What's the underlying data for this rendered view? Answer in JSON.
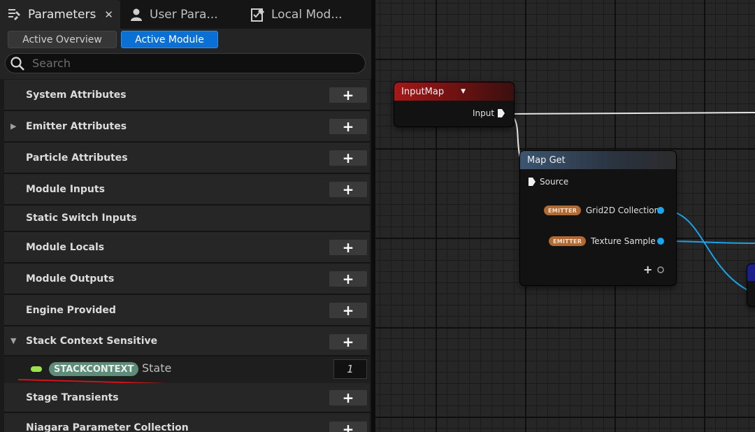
{
  "tabs": [
    {
      "label": "Parameters",
      "icon": "wrench-list-icon",
      "active": true,
      "closable": true
    },
    {
      "label": "User Para...",
      "icon": "person-icon",
      "active": false
    },
    {
      "label": "Local Mod...",
      "icon": "checklist-pencil-icon",
      "active": false
    }
  ],
  "modes": {
    "overview": "Active Overview",
    "module": "Active Module",
    "selected": "Active Module"
  },
  "search": {
    "placeholder": "Search",
    "value": ""
  },
  "categories": {
    "system": "System Attributes",
    "emitter": "Emitter Attributes",
    "particle": "Particle Attributes",
    "module_inputs": "Module Inputs",
    "static_switch": "Static Switch Inputs",
    "module_locals": "Module Locals",
    "module_outputs": "Module Outputs",
    "engine": "Engine Provided",
    "stack_context": "Stack Context Sensitive",
    "stage_transients": "Stage Transients",
    "npc": "Niagara Parameter Collection"
  },
  "param": {
    "namespace": "STACKCONTEXT",
    "name": "State",
    "value": "1"
  },
  "colors": {
    "accent_blue": "#0a70d6",
    "param_type_green": "#9be34a",
    "namespace_badge": "#5e8c78",
    "emitter_badge": "#b26a35",
    "pin_blue": "#19a6ee",
    "annotation_red": "#d0141a"
  },
  "graph": {
    "inputmap": {
      "title": "InputMap",
      "output_pin": "Input"
    },
    "mapget": {
      "title": "Map Get",
      "source_pin": "Source",
      "outputs": [
        {
          "badge": "EMITTER",
          "label": "Grid2D Collection"
        },
        {
          "badge": "EMITTER",
          "label": "Texture Sample"
        }
      ],
      "add_pin": "+"
    }
  }
}
